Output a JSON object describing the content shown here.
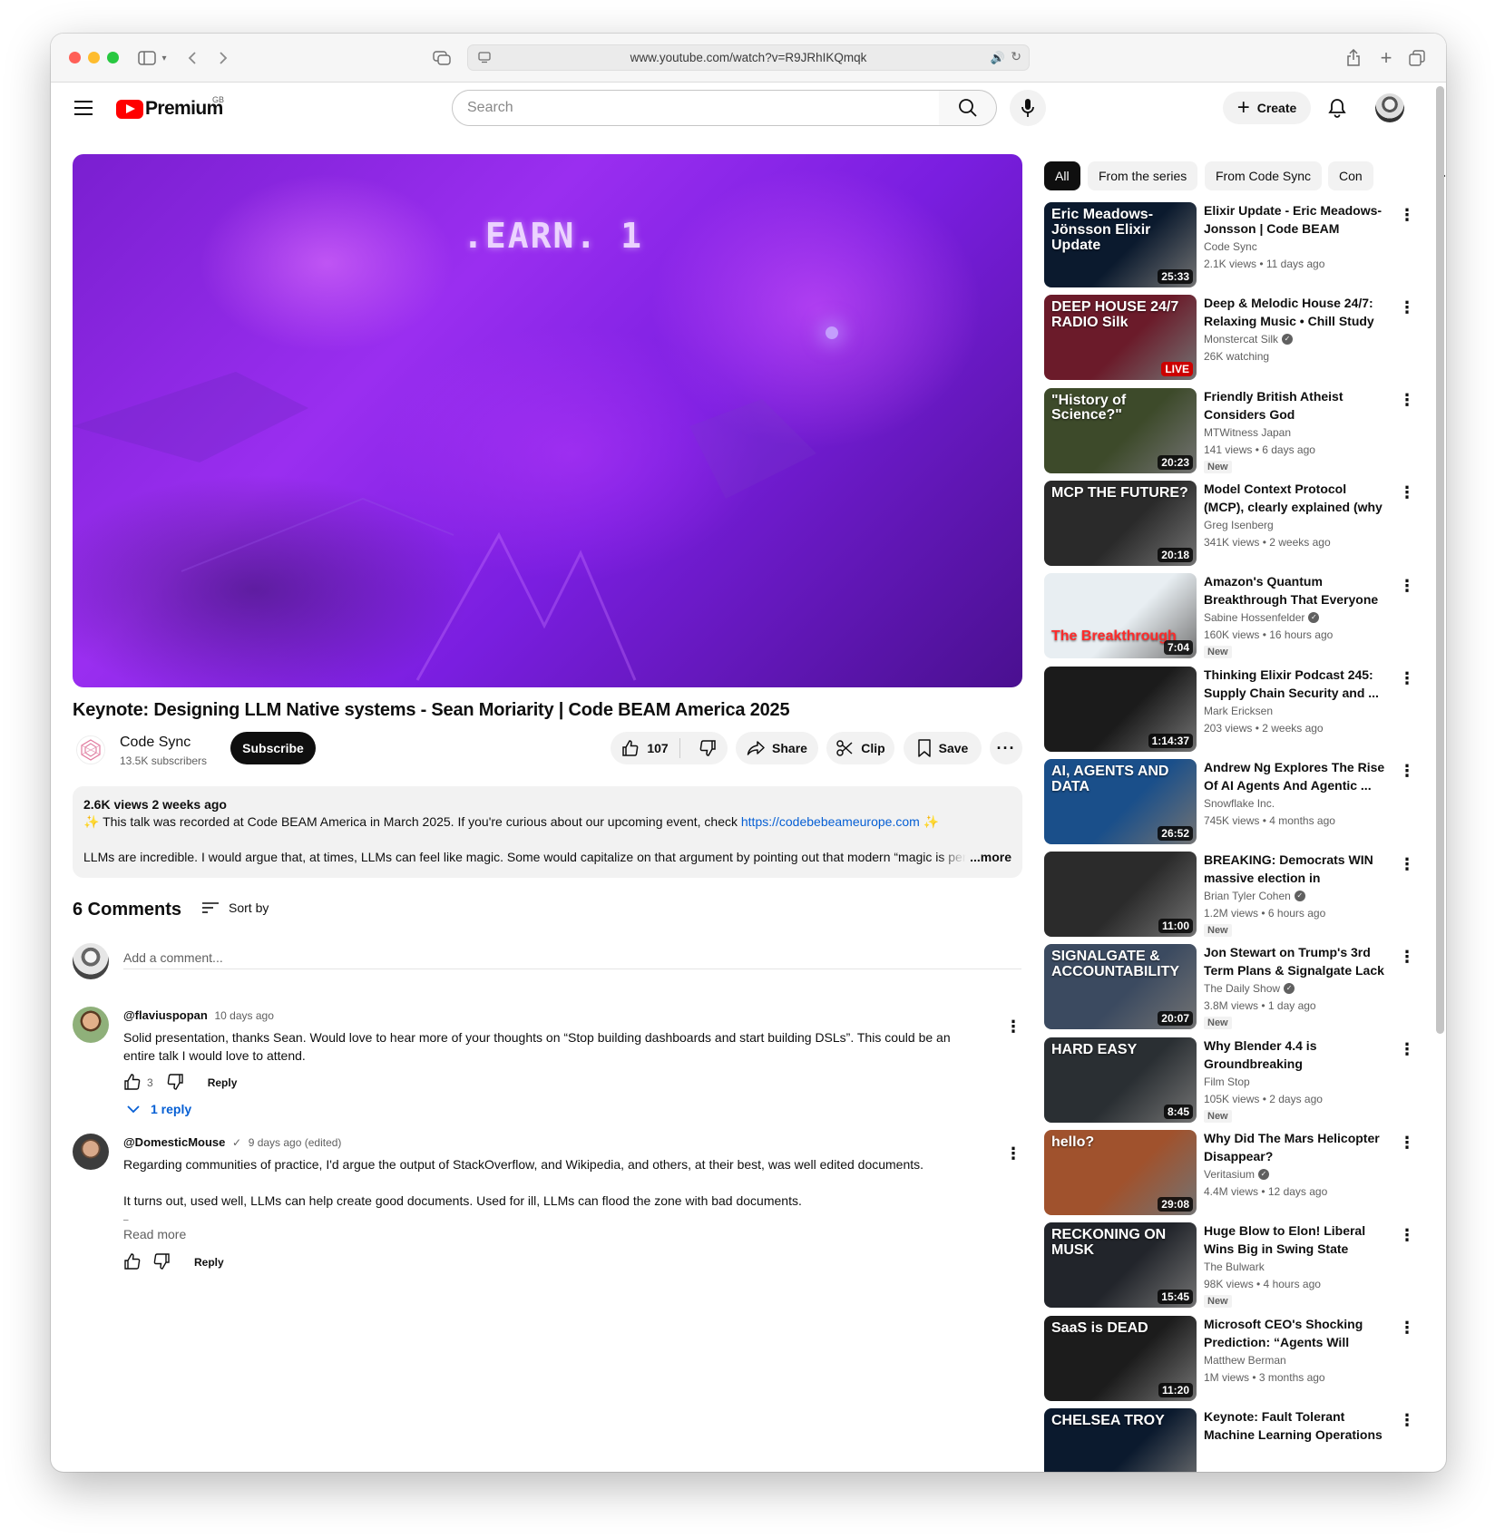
{
  "browser": {
    "url": "www.youtube.com/watch?v=R9JRhIKQmqk"
  },
  "header": {
    "logo_text": "Premium",
    "logo_region": "GB",
    "search_placeholder": "Search",
    "create_label": "Create"
  },
  "video": {
    "overlay_text": ".EARN. 1",
    "title": "Keynote: Designing LLM Native systems - Sean Moriarity | Code BEAM America 2025",
    "channel": "Code Sync",
    "subscribers": "13.5K subscribers",
    "subscribe_label": "Subscribe",
    "likes": "107",
    "share_label": "Share",
    "clip_label": "Clip",
    "save_label": "Save"
  },
  "description": {
    "meta": "2.6K views  2 weeks ago",
    "line1_sparkle_left": "✨",
    "line1_text": " This talk was recorded at Code BEAM America in March 2025. If you're curious about our upcoming event, check ",
    "line1_link": "https://codebebeameurope.com",
    "line1_sparkle_right": " ✨",
    "line2": "LLMs are incredible. I would argue that, at times, LLMs can feel like magic. Some would capitalize on that argument by pointing out that modern “magic is per",
    "more_label": "...more"
  },
  "comments": {
    "count_label": "6 Comments",
    "sort_label": "Sort by",
    "add_placeholder": "Add a comment...",
    "items": [
      {
        "handle": "@flaviuspopan",
        "time": "10 days ago",
        "body": "Solid presentation, thanks Sean. Would love to hear more of your thoughts on “Stop building dashboards and start building DSLs”. This could be an entire talk I would love to attend.",
        "likes": "3",
        "reply_label": "Reply",
        "replies_label": "1 reply"
      },
      {
        "handle": "@DomesticMouse",
        "check": "✓",
        "time": "9 days ago (edited)",
        "body_p1": "Regarding communities of practice, I'd argue the output of StackOverflow, and Wikipedia, and others, at their best, was well edited documents.",
        "body_p2": "It turns out, used well, LLMs can help create good documents. Used for ill, LLMs can flood the zone with bad documents.",
        "body_p3": "–",
        "read_more": "Read more",
        "reply_label": "Reply"
      }
    ]
  },
  "sidebar": {
    "chips": [
      "All",
      "From the series",
      "From Code Sync",
      "Con"
    ],
    "recommendations": [
      {
        "title": "Elixir Update - Eric Meadows-Jonsson | Code BEAM Americ...",
        "channel": "Code Sync",
        "verified": false,
        "stats": "2.1K views • 11 days ago",
        "duration": "25:33",
        "is_new": false,
        "thumb_text": "Eric Meadows-Jönsson Elixir Update",
        "thumb_color": "#0b1a2e"
      },
      {
        "title": "Deep & Melodic House 24/7: Relaxing Music • Chill Study ...",
        "channel": "Monstercat Silk",
        "verified": true,
        "stats": "26K watching",
        "duration": "LIVE",
        "is_live": true,
        "is_new": false,
        "thumb_text": "DEEP HOUSE 24/7 RADIO Silk",
        "thumb_color": "#6b1b2a"
      },
      {
        "title": "Friendly British Atheist Considers God",
        "channel": "MTWitness Japan",
        "verified": false,
        "stats": "141 views • 6 days ago",
        "duration": "20:23",
        "is_new": true,
        "thumb_text": "\"History of Science?\"",
        "thumb_color": "#3d4a2a"
      },
      {
        "title": "Model Context Protocol (MCP), clearly explained (why it ...",
        "channel": "Greg Isenberg",
        "verified": false,
        "stats": "341K views • 2 weeks ago",
        "duration": "20:18",
        "is_new": false,
        "thumb_text": "MCP THE FUTURE?",
        "thumb_color": "#2a2a2a"
      },
      {
        "title": "Amazon's Quantum Breakthrough That Everyone ...",
        "channel": "Sabine Hossenfelder",
        "verified": true,
        "stats": "160K views • 16 hours ago",
        "duration": "7:04",
        "is_new": true,
        "thumb_text": "The Breakthrough",
        "thumb_color": "#e8eef2"
      },
      {
        "title": "Thinking Elixir Podcast 245: Supply Chain Security and ...",
        "channel": "Mark Ericksen",
        "verified": false,
        "stats": "203 views • 2 weeks ago",
        "duration": "1:14:37",
        "is_new": false,
        "thumb_text": "",
        "thumb_color": "#1b1b1b"
      },
      {
        "title": "Andrew Ng Explores The Rise Of AI Agents And Agentic ...",
        "channel": "Snowflake Inc.",
        "verified": false,
        "stats": "745K views • 4 months ago",
        "duration": "26:52",
        "is_new": false,
        "thumb_text": "AI, AGENTS AND DATA",
        "thumb_color": "#1a4f8a"
      },
      {
        "title": "BREAKING: Democrats WIN massive election in Wisconsin",
        "channel": "Brian Tyler Cohen",
        "verified": true,
        "stats": "1.2M views • 6 hours ago",
        "duration": "11:00",
        "is_new": true,
        "thumb_text": "",
        "thumb_color": "#2b2b2b"
      },
      {
        "title": "Jon Stewart on Trump's 3rd Term Plans & Signalgate Lack ...",
        "channel": "The Daily Show",
        "verified": true,
        "stats": "3.8M views • 1 day ago",
        "duration": "20:07",
        "is_new": true,
        "thumb_text": "SIGNALGATE & ACCOUNTABILITY",
        "thumb_color": "#3b4a60"
      },
      {
        "title": "Why Blender 4.4 is Groundbreaking",
        "channel": "Film Stop",
        "verified": false,
        "stats": "105K views • 2 days ago",
        "duration": "8:45",
        "is_new": true,
        "thumb_text": "HARD        EASY",
        "thumb_color": "#2a2f33"
      },
      {
        "title": "Why Did The Mars Helicopter Disappear?",
        "channel": "Veritasium",
        "verified": true,
        "stats": "4.4M views • 12 days ago",
        "duration": "29:08",
        "is_new": false,
        "thumb_text": "hello?",
        "thumb_color": "#a0522d"
      },
      {
        "title": "Huge Blow to Elon! Liberal Wins Big in Swing State Supreme ...",
        "channel": "The Bulwark",
        "verified": false,
        "stats": "98K views • 4 hours ago",
        "duration": "15:45",
        "is_new": true,
        "thumb_text": "RECKONING ON MUSK",
        "thumb_color": "#22252b"
      },
      {
        "title": "Microsoft CEO's Shocking Prediction: “Agents Will Repla...",
        "channel": "Matthew Berman",
        "verified": false,
        "stats": "1M views • 3 months ago",
        "duration": "11:20",
        "is_new": false,
        "thumb_text": "SaaS is DEAD",
        "thumb_color": "#1c1c1c"
      },
      {
        "title": "Keynote: Fault Tolerant Machine Learning Operations - Chelsea ...",
        "channel": "",
        "verified": false,
        "stats": "",
        "duration": "",
        "is_new": false,
        "thumb_text": "CHELSEA TROY",
        "thumb_color": "#0b1a2e"
      }
    ]
  },
  "colors": {
    "brand_red": "#ff0000",
    "link_blue": "#065fd4",
    "chip_active": "#0f0f0f"
  }
}
